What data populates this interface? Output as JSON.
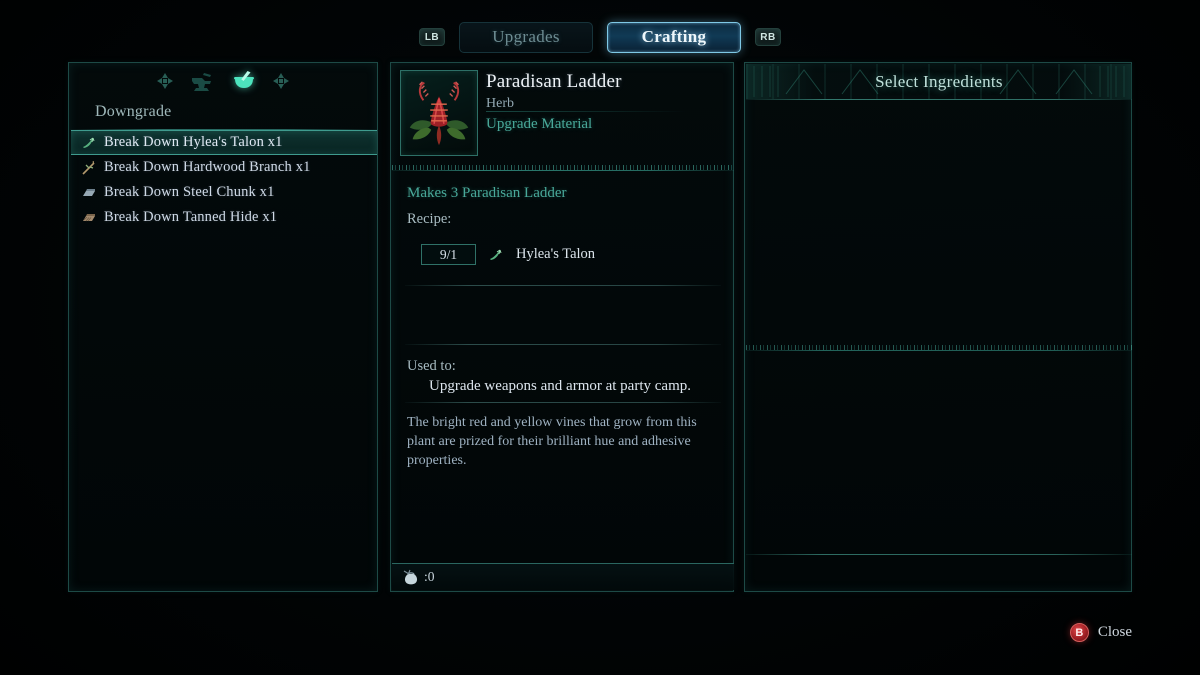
{
  "tabbar": {
    "left_bumper": "LB",
    "right_bumper": "RB",
    "tabs": [
      {
        "label": "Upgrades",
        "active": false
      },
      {
        "label": "Crafting",
        "active": true
      }
    ]
  },
  "left_panel": {
    "station_icons": [
      "dpad-left-icon",
      "anvil-icon",
      "mortar-pestle-icon",
      "dpad-right-icon"
    ],
    "section_label": "Downgrade",
    "items": [
      {
        "label": "Break Down Hylea's Talon  x1",
        "icon": "herb-icon",
        "selected": true
      },
      {
        "label": "Break Down Hardwood Branch  x1",
        "icon": "branch-icon",
        "selected": false
      },
      {
        "label": "Break Down Steel Chunk  x1",
        "icon": "ingot-icon",
        "selected": false
      },
      {
        "label": "Break Down Tanned Hide  x1",
        "icon": "hide-icon",
        "selected": false
      }
    ]
  },
  "center_panel": {
    "item_name": "Paradisan Ladder",
    "item_type": "Herb",
    "item_category": "Upgrade Material",
    "item_icon": "paradisan-ladder-plant-icon",
    "makes_line": "Makes 3 Paradisan Ladder",
    "recipe_label": "Recipe:",
    "recipe": [
      {
        "quantity": "9/1",
        "icon": "herb-icon",
        "name": "Hylea's Talon"
      }
    ],
    "used_to_label": "Used to:",
    "used_to_text": "Upgrade weapons and armor at party camp.",
    "flavor_text": "The bright red and yellow vines that grow from this plant are prized for their brilliant hue and adhesive properties.",
    "weight_icon": "coin-pouch-icon",
    "weight_value": ":0"
  },
  "right_panel": {
    "title": "Select Ingredients"
  },
  "footer": {
    "close_button_glyph": "B",
    "close_label": "Close"
  },
  "colors": {
    "accent_teal": "#49a99a",
    "accent_cyan": "#7fc9e6",
    "panel_border": "#1d4a46",
    "text_primary": "#dde6ee",
    "text_muted": "#9fb2c2",
    "button_red": "#c8323a",
    "background": "#000000"
  }
}
